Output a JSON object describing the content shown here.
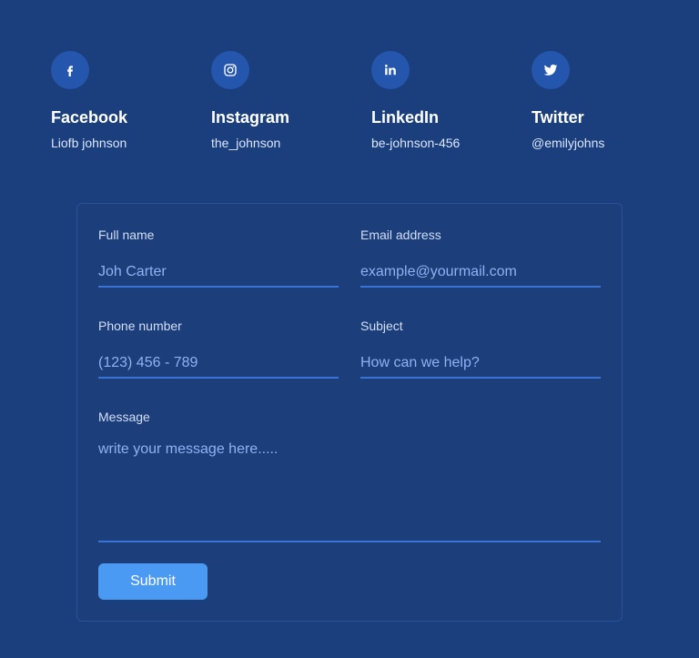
{
  "colors": {
    "background": "#1b3f7c",
    "icon_circle": "#2456ad",
    "input_underline": "#3a73d6",
    "placeholder_text": "#8fb1f1",
    "button": "#4a9af3"
  },
  "socials": [
    {
      "name": "Facebook",
      "handle": "Liofb johnson",
      "icon": "facebook-icon"
    },
    {
      "name": "Instagram",
      "handle": "the_johnson",
      "icon": "instagram-icon"
    },
    {
      "name": "LinkedIn",
      "handle": "be-johnson-456",
      "icon": "linkedin-icon"
    },
    {
      "name": "Twitter",
      "handle": "@emilyjohns",
      "icon": "twitter-icon"
    }
  ],
  "form": {
    "full_name": {
      "label": "Full name",
      "placeholder": "Joh Carter"
    },
    "email": {
      "label": "Email address",
      "placeholder": "example@yourmail.com"
    },
    "phone": {
      "label": "Phone number",
      "placeholder": "(123) 456 - 789"
    },
    "subject": {
      "label": "Subject",
      "placeholder": "How can we help?"
    },
    "message": {
      "label": "Message",
      "placeholder": "write your message here....."
    },
    "submit_label": "Submit"
  }
}
